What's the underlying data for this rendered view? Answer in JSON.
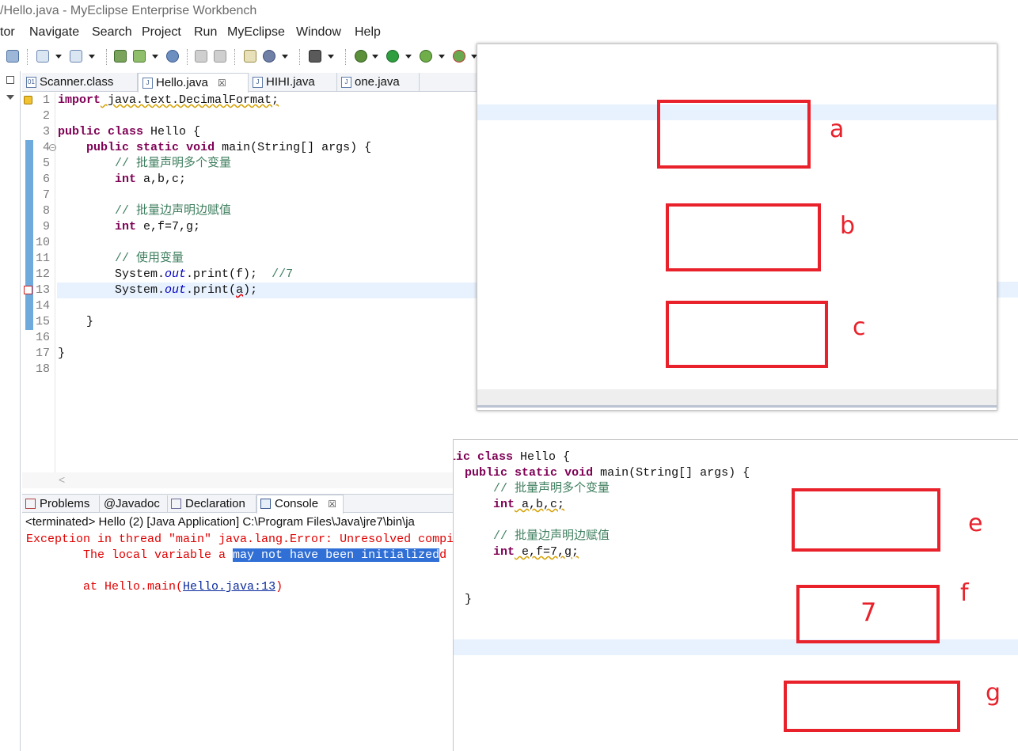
{
  "window": {
    "title": "/Hello.java - MyEclipse Enterprise Workbench"
  },
  "menu": [
    "tor",
    "Navigate",
    "Search",
    "Project",
    "Run",
    "MyEclipse",
    "Window",
    "Help"
  ],
  "editor_tabs": [
    {
      "label": "Scanner.class",
      "icon": "class-file-icon",
      "active": false
    },
    {
      "label": "Hello.java",
      "icon": "java-file-icon",
      "active": true,
      "close": "☒"
    },
    {
      "label": "HIHI.java",
      "icon": "java-file-icon",
      "active": false
    },
    {
      "label": "one.java",
      "icon": "java-file-icon",
      "active": false
    }
  ],
  "editor": {
    "line_numbers": [
      "1",
      "2",
      "3",
      "4",
      "5",
      "6",
      "7",
      "8",
      "9",
      "10",
      "11",
      "12",
      "13",
      "14",
      "15",
      "16",
      "17",
      "18"
    ],
    "lines": {
      "l1_kw": "import",
      "l1_rest": " java.text.DecimalFormat;",
      "l3_kw1": "public",
      "l3_sp": " ",
      "l3_kw2": "class",
      "l3_rest": " Hello {",
      "l4_indent": "    ",
      "l4_kw1": "public",
      "l4_kw2": "static",
      "l4_kw3": "void",
      "l4_rest": " main(String[] args) {",
      "l5": "        // 批量声明多个变量",
      "l6_indent": "        ",
      "l6_kw": "int",
      "l6_rest": " a,b,c;",
      "l8": "        // 批量边声明边赋值",
      "l9_indent": "        ",
      "l9_kw": "int",
      "l9_rest": " e,f=7,g;",
      "l11": "        // 使用变量",
      "l12_a": "        System.",
      "l12_out": "out",
      "l12_b": ".print(f);  ",
      "l12_cm": "//7",
      "l13_a": "        System.",
      "l13_out": "out",
      "l13_b": ".print(",
      "l13_err": "a",
      "l13_c": ");",
      "l15": "    }",
      "l17": "}"
    }
  },
  "bottom_tabs": [
    {
      "label": "Problems",
      "icon": "problems-icon"
    },
    {
      "label": "Javadoc",
      "prefix": "@"
    },
    {
      "label": "Declaration",
      "icon": "declaration-icon"
    },
    {
      "label": "Console",
      "icon": "console-icon",
      "active": true,
      "close": "☒"
    }
  ],
  "console": {
    "header": "<terminated> Hello (2) [Java Application] C:\\Program Files\\Java\\jre7\\bin\\ja",
    "line1": "Exception in thread \"main\" java.lang.Error: Unresolved compi",
    "line2_pre": "        The local variable a ",
    "line2_sel": "may not have been initialized",
    "line2_post": "d",
    "line3_pre": "        at Hello.main(",
    "line3_link": "Hello.java:13",
    "line3_post": ")"
  },
  "panel1": {
    "labels": [
      "a",
      "b",
      "c"
    ]
  },
  "panel2": {
    "code": {
      "l1_kw1": "lic",
      "l1_kw2": "class",
      "l1_rest": " Hello {",
      "l2_kw1": "public",
      "l2_kw2": "static",
      "l2_kw3": "void",
      "l2_rest": " main(String[] args) {",
      "l3": "// 批量声明多个变量",
      "l4_kw": "int",
      "l4_rest": " a,b,c;",
      "l5": "// 批量边声明边赋值",
      "l6_kw": "int",
      "l6_rest": " e,f=7,g;",
      "l7": "}"
    },
    "labels": [
      "e",
      "f",
      "g"
    ],
    "f_value": "7"
  },
  "colors": {
    "annotation_red": "#e8212b",
    "keyword": "#7f0055",
    "comment": "#3f7f5f",
    "static_field": "#0000c0",
    "console_error": "#e00000",
    "selection": "#2f6fd6",
    "current_line": "#e8f2fe"
  }
}
